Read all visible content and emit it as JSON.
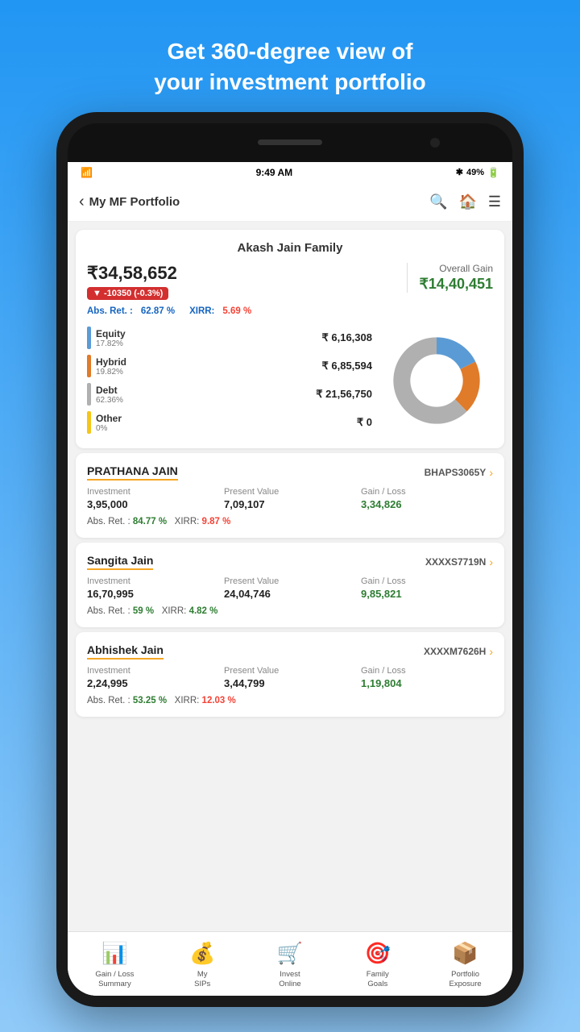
{
  "header": {
    "line1": "Get 360-degree view of",
    "line2": "your investment portfolio"
  },
  "statusBar": {
    "time": "9:49 AM",
    "battery": "49%"
  },
  "nav": {
    "back": "‹",
    "title": "My MF Portfolio"
  },
  "portfolio": {
    "family_name": "Akash Jain Family",
    "total_value": "₹34,58,652",
    "change": "▼ -10350  (-0.3%)",
    "overall_gain_label": "Overall Gain",
    "overall_gain_value": "₹14,40,451",
    "abs_ret_label": "Abs. Ret. :",
    "abs_ret_value": "62.87 %",
    "xirr_label": "XIRR:",
    "xirr_value": "5.69 %",
    "segments": [
      {
        "name": "Equity",
        "pct": "17.82%",
        "value": "₹ 6,16,308",
        "color": "#5b9bd5",
        "donut_pct": 17.82
      },
      {
        "name": "Hybrid",
        "pct": "19.82%",
        "value": "₹ 6,85,594",
        "color": "#e07b2a",
        "donut_pct": 19.82
      },
      {
        "name": "Debt",
        "pct": "62.36%",
        "value": "₹ 21,56,750",
        "color": "#b0b0b0",
        "donut_pct": 62.36
      },
      {
        "name": "Other",
        "pct": "0%",
        "value": "₹ 0",
        "color": "#f5c518",
        "donut_pct": 0
      }
    ]
  },
  "members": [
    {
      "name": "PRATHANA JAIN",
      "id": "BHAPS3065Y",
      "investment_label": "Investment",
      "investment": "3,95,000",
      "pv_label": "Present Value",
      "pv": "7,09,107",
      "gl_label": "Gain / Loss",
      "gl": "3,34,826",
      "abs_ret_label": "Abs. Ret. :",
      "abs_ret": "84.77 %",
      "xirr_label": "XIRR:",
      "xirr": "9.87 %",
      "xirr_color": "red"
    },
    {
      "name": "Sangita Jain",
      "id": "XXXXS7719N",
      "investment_label": "Investment",
      "investment": "16,70,995",
      "pv_label": "Present Value",
      "pv": "24,04,746",
      "gl_label": "Gain / Loss",
      "gl": "9,85,821",
      "abs_ret_label": "Abs. Ret. :",
      "abs_ret": "59 %",
      "xirr_label": "XIRR:",
      "xirr": "4.82 %",
      "xirr_color": "green"
    },
    {
      "name": "Abhishek Jain",
      "id": "XXXXM7626H",
      "investment_label": "Investment",
      "investment": "2,24,995",
      "pv_label": "Present Value",
      "pv": "3,44,799",
      "gl_label": "Gain / Loss",
      "gl": "1,19,804",
      "abs_ret_label": "Abs. Ret. :",
      "abs_ret": "53.25 %",
      "xirr_label": "XIRR:",
      "xirr": "12.03 %",
      "xirr_color": "red"
    }
  ],
  "bottomNav": [
    {
      "id": "gain-loss",
      "label": "Gain / Loss\nSummary",
      "icon": "📊"
    },
    {
      "id": "my-sips",
      "label": "My\nSIPs",
      "icon": "💰"
    },
    {
      "id": "invest",
      "label": "Invest\nOnline",
      "icon": "🛒"
    },
    {
      "id": "family",
      "label": "Family\nGoals",
      "icon": "🎯"
    },
    {
      "id": "portfolio",
      "label": "Portfolio\nExposure",
      "icon": "📦"
    }
  ]
}
